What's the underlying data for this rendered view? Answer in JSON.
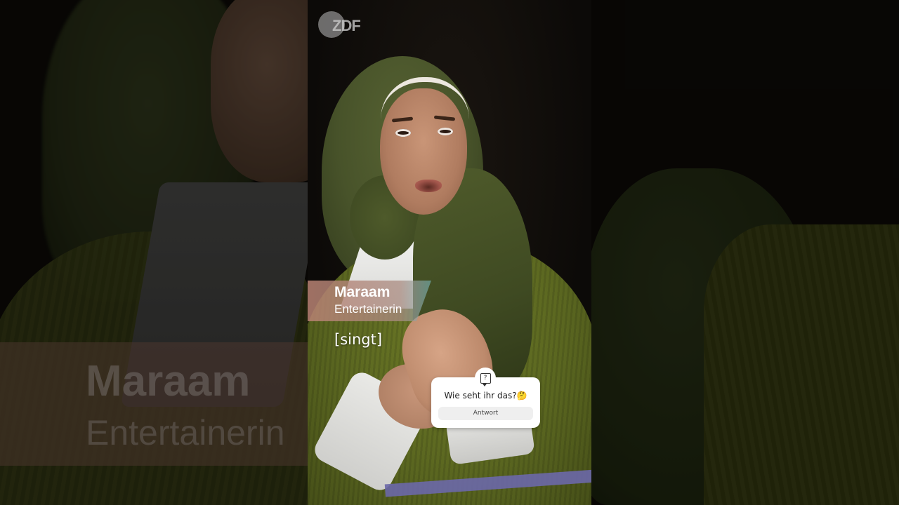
{
  "video": {
    "channel_logo": "ZDF",
    "lower_third": {
      "name": "Maraam",
      "role": "Entertainerin"
    },
    "subtitle": "[singt]",
    "background_blur": {
      "name": "Maraam",
      "role": "Entertainerin"
    }
  },
  "question_sticker": {
    "icon": "question-bubble-icon",
    "prompt": "Wie seht ihr das?🤔",
    "answer_label": "Antwort"
  },
  "colors": {
    "scarf": "#4f5b2b",
    "sweater": "#5a6620",
    "name_card": "#b98273",
    "sticker_bg": "#ffffff"
  }
}
